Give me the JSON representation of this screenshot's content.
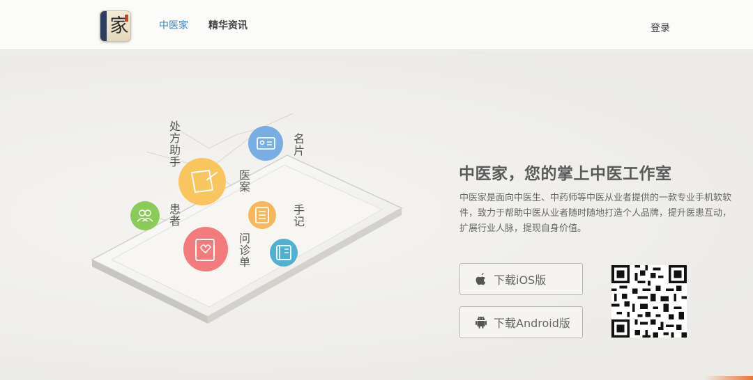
{
  "header": {
    "logo_alt": "中医家",
    "logo_char": "家",
    "nav": [
      {
        "label": "中医家",
        "active": true
      },
      {
        "label": "精华资讯",
        "active": false
      }
    ],
    "login_label": "登录"
  },
  "hero": {
    "features": {
      "prescription": "处方助手",
      "case": "医案",
      "card": "名片",
      "patients": "患者",
      "notes": "手记",
      "questionnaire": "问诊单"
    },
    "headline": "中医家，您的掌上中医工作室",
    "description": "中医家是面向中医生、中药师等中医从业者提供的一款专业手机软软件，致力于帮助中医从业者随时随地打造个人品牌，提升医患互动，扩展行业人脉，提现自身价值。",
    "buttons": {
      "ios": "下载iOS版",
      "android": "下载Android版"
    }
  },
  "colors": {
    "accent_blue": "#3f84c4",
    "case_yellow": "#f9c55e",
    "card_blue": "#78aee4",
    "patients_green": "#8ccb59",
    "notes_orange": "#f6b85a",
    "questionnaire_red": "#f27c7c",
    "extra_teal": "#4fb0cf"
  },
  "icons": [
    "apple-icon",
    "android-icon",
    "qr-code"
  ]
}
